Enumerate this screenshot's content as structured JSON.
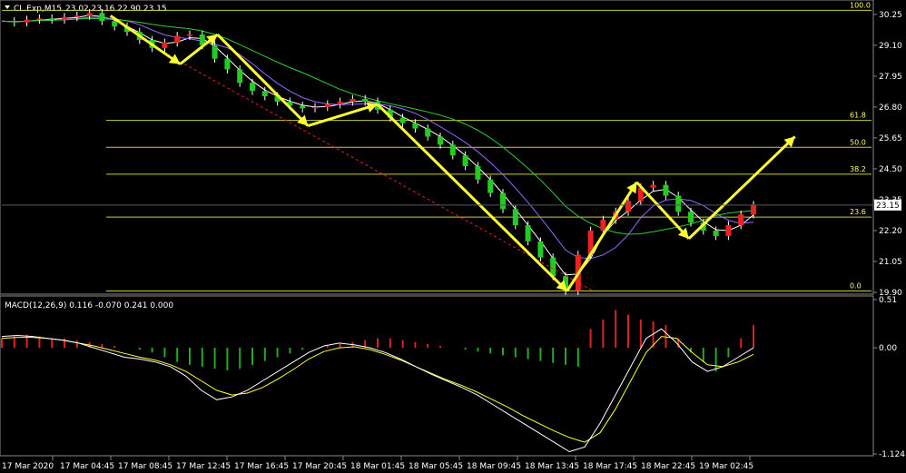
{
  "header": {
    "symbol": "CL.Exp,M15",
    "ohlc": "23.02 23.16 22.90 23.15"
  },
  "chart_data": {
    "type": "line",
    "title": "CL.Exp,M15",
    "price_axis": {
      "ticks": [
        "30.25",
        "29.10",
        "27.95",
        "26.80",
        "25.65",
        "24.50",
        "23.35",
        "22.20",
        "21.05",
        "19.90"
      ],
      "tick_values": [
        30.25,
        29.1,
        27.95,
        26.8,
        25.65,
        24.5,
        23.35,
        22.2,
        21.05,
        19.9
      ],
      "ylim": [
        19.9,
        30.65
      ],
      "current_price": "23.15"
    },
    "time_axis": {
      "labels": [
        "17 Mar 2020",
        "17 Mar 04:45",
        "17 Mar 08:45",
        "17 Mar 12:45",
        "17 Mar 16:45",
        "17 Mar 20:45",
        "18 Mar 01:45",
        "18 Mar 05:45",
        "18 Mar 09:45",
        "18 Mar 13:45",
        "18 Mar 17:45",
        "18 Mar 22:45",
        "19 Mar 02:45"
      ]
    },
    "fibonacci": [
      {
        "level": "100.0",
        "price": 30.4
      },
      {
        "level": "61.8",
        "price": 26.3
      },
      {
        "level": "50.0",
        "price": 25.3
      },
      {
        "level": "38.2",
        "price": 24.3
      },
      {
        "level": "23.6",
        "price": 22.7
      },
      {
        "level": "0.0",
        "price": 19.95
      }
    ],
    "price_series": [
      30.0,
      29.95,
      30.05,
      30.1,
      30.05,
      30.15,
      30.2,
      30.3,
      30.0,
      29.8,
      29.6,
      29.3,
      29.0,
      29.2,
      29.45,
      29.5,
      29.1,
      28.6,
      28.2,
      27.7,
      27.4,
      27.2,
      27.0,
      26.85,
      26.75,
      26.8,
      26.9,
      27.0,
      27.1,
      27.0,
      26.7,
      26.4,
      26.2,
      26.0,
      25.7,
      25.4,
      25.0,
      24.6,
      24.1,
      23.6,
      23.0,
      22.4,
      21.8,
      21.2,
      20.5,
      19.95,
      21.3,
      22.2,
      22.6,
      22.9,
      23.3,
      23.8,
      23.9,
      23.5,
      22.9,
      22.5,
      22.2,
      22.0,
      22.4,
      22.8,
      23.15
    ],
    "moving_averages": [
      {
        "color": "#ffffff"
      },
      {
        "color": "#9966ff"
      },
      {
        "color": "#33cc33"
      }
    ],
    "zigzag": [
      {
        "x": 0.125,
        "y": 30.2
      },
      {
        "x": 0.205,
        "y": 28.4
      },
      {
        "x": 0.248,
        "y": 29.5
      },
      {
        "x": 0.352,
        "y": 26.1
      },
      {
        "x": 0.432,
        "y": 26.9
      },
      {
        "x": 0.65,
        "y": 19.95
      },
      {
        "x": 0.73,
        "y": 24.0
      },
      {
        "x": 0.79,
        "y": 21.9
      },
      {
        "x": 0.912,
        "y": 25.7
      }
    ],
    "macd": {
      "label": "MACD(12,26,9) 0.116 -0.070 0.241 0.000",
      "ticks": [
        "0.51",
        "0.00",
        "-1.124"
      ],
      "tick_values": [
        0.51,
        0.0,
        -1.124
      ],
      "ylim": [
        -1.124,
        0.51
      ],
      "histogram": [
        0.1,
        0.12,
        0.14,
        0.12,
        0.1,
        0.1,
        0.08,
        0.06,
        0.04,
        0.02,
        0.0,
        -0.02,
        -0.05,
        -0.1,
        -0.15,
        -0.18,
        -0.2,
        -0.22,
        -0.24,
        -0.22,
        -0.18,
        -0.14,
        -0.1,
        -0.06,
        -0.02,
        0.0,
        0.02,
        0.04,
        0.06,
        0.08,
        0.1,
        0.1,
        0.08,
        0.06,
        0.04,
        0.02,
        0.0,
        -0.02,
        -0.04,
        -0.06,
        -0.08,
        -0.1,
        -0.12,
        -0.14,
        -0.16,
        -0.18,
        -0.2,
        0.2,
        0.3,
        0.4,
        0.35,
        0.3,
        0.28,
        0.24,
        0.1,
        -0.05,
        -0.15,
        -0.25,
        -0.1,
        0.1,
        0.24
      ],
      "macd_line": [
        0.12,
        0.13,
        0.12,
        0.1,
        0.08,
        0.05,
        0.0,
        -0.05,
        -0.1,
        -0.12,
        -0.15,
        -0.2,
        -0.3,
        -0.45,
        -0.55,
        -0.52,
        -0.45,
        -0.35,
        -0.25,
        -0.15,
        -0.05,
        0.02,
        0.05,
        0.03,
        0.0,
        -0.05,
        -0.12,
        -0.2,
        -0.28,
        -0.35,
        -0.42,
        -0.5,
        -0.6,
        -0.7,
        -0.8,
        -0.9,
        -1.0,
        -1.1,
        -1.05,
        -0.8,
        -0.5,
        -0.2,
        0.1,
        0.2,
        0.05,
        -0.15,
        -0.25,
        -0.2,
        -0.1,
        0.0
      ],
      "signal_line": [
        0.1,
        0.11,
        0.11,
        0.1,
        0.08,
        0.05,
        0.02,
        -0.02,
        -0.06,
        -0.1,
        -0.13,
        -0.18,
        -0.25,
        -0.35,
        -0.45,
        -0.5,
        -0.48,
        -0.42,
        -0.33,
        -0.23,
        -0.12,
        -0.04,
        0.0,
        0.01,
        -0.02,
        -0.07,
        -0.13,
        -0.2,
        -0.27,
        -0.34,
        -0.4,
        -0.47,
        -0.55,
        -0.63,
        -0.72,
        -0.8,
        -0.88,
        -0.95,
        -1.0,
        -0.9,
        -0.65,
        -0.35,
        -0.05,
        0.12,
        0.1,
        -0.05,
        -0.18,
        -0.2,
        -0.15,
        -0.07
      ]
    },
    "grid": false
  }
}
